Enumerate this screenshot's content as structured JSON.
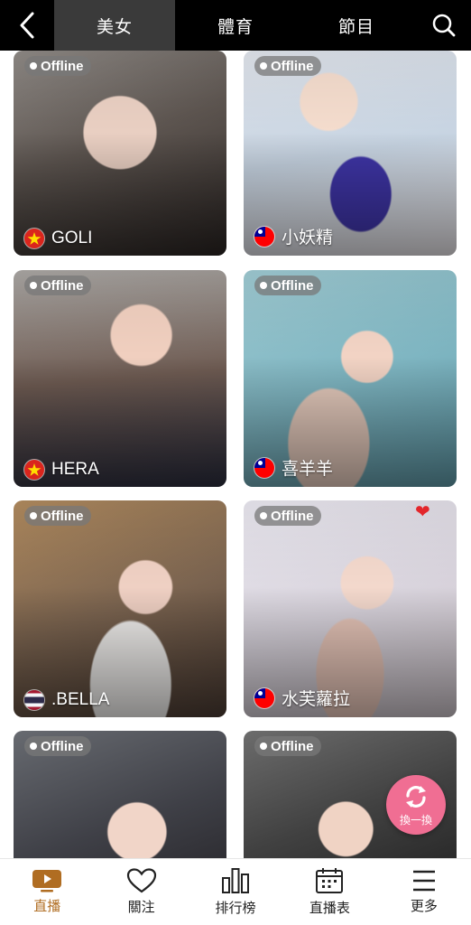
{
  "header": {
    "tabs": [
      {
        "label": "美女",
        "active": true
      },
      {
        "label": "體育",
        "active": false
      },
      {
        "label": "節目",
        "active": false
      }
    ],
    "back_icon": "chevron-left-icon",
    "search_icon": "search-icon"
  },
  "cards": [
    {
      "status": "Offline",
      "name": "GOLI",
      "flag": "vietnam"
    },
    {
      "status": "Offline",
      "name": "小妖精",
      "flag": "taiwan"
    },
    {
      "status": "Offline",
      "name": "HERA",
      "flag": "vietnam"
    },
    {
      "status": "Offline",
      "name": "喜羊羊",
      "flag": "taiwan"
    },
    {
      "status": "Offline",
      "name": ".BELLA",
      "flag": "thailand"
    },
    {
      "status": "Offline",
      "name": "水芙蘿拉",
      "flag": "taiwan"
    },
    {
      "status": "Offline",
      "name": "",
      "flag": ""
    },
    {
      "status": "Offline",
      "name": "",
      "flag": ""
    }
  ],
  "refresh_button": {
    "label": "換一換",
    "icon": "refresh-icon"
  },
  "bottom_nav": [
    {
      "label": "直播",
      "icon": "tv-play-icon",
      "active": true
    },
    {
      "label": "關注",
      "icon": "heart-icon",
      "active": false
    },
    {
      "label": "排行榜",
      "icon": "bar-chart-icon",
      "active": false
    },
    {
      "label": "直播表",
      "icon": "calendar-icon",
      "active": false
    },
    {
      "label": "更多",
      "icon": "menu-icon",
      "active": false
    }
  ],
  "colors": {
    "accent": "#b06d22",
    "refresh": "#f06e93",
    "topbar": "#000000"
  }
}
